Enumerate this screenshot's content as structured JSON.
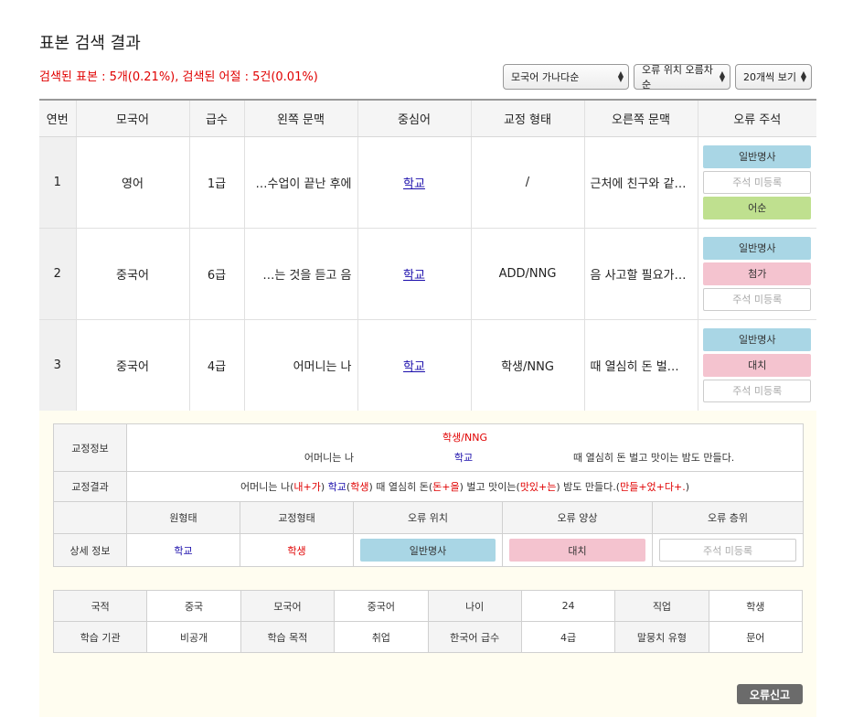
{
  "title": "표본 검색 결과",
  "summary": "검색된 표본 : 5개(0.21%), 검색된 어절 : 5건(0.01%)",
  "selects": {
    "sort_lang": "모국어 가나다순",
    "sort_err": "오류 위치 오름차순",
    "page_size": "20개씩 보기"
  },
  "table": {
    "headers": [
      "연번",
      "모국어",
      "급수",
      "왼쪽 문맥",
      "중심어",
      "교정 형태",
      "오른쪽 문맥",
      "오류 주석"
    ],
    "rows": [
      {
        "no": "1",
        "lang": "영어",
        "level": "1급",
        "left": "…수업이 끝난 후에",
        "keyword": "학교",
        "corr": "/",
        "right": "근처에 친구와 같…",
        "tags": [
          {
            "label": "일반명사",
            "style": "blue"
          },
          {
            "label": "주석 미등록",
            "style": "empty"
          },
          {
            "label": "어순",
            "style": "green"
          }
        ]
      },
      {
        "no": "2",
        "lang": "중국어",
        "level": "6급",
        "left": "…는 것을 듣고 음",
        "keyword": "학교",
        "corr": "ADD/NNG",
        "right": "음 사고할 필요가…",
        "tags": [
          {
            "label": "일반명사",
            "style": "blue"
          },
          {
            "label": "첨가",
            "style": "pink"
          },
          {
            "label": "주석 미등록",
            "style": "empty"
          }
        ]
      },
      {
        "no": "3",
        "lang": "중국어",
        "level": "4급",
        "left": "어머니는 나",
        "keyword": "학교",
        "corr": "학생/NNG",
        "right": "때 열심히 돈 벌…",
        "tags": [
          {
            "label": "일반명사",
            "style": "blue"
          },
          {
            "label": "대치",
            "style": "pink"
          },
          {
            "label": "주석 미등록",
            "style": "empty"
          }
        ]
      }
    ]
  },
  "detail": {
    "corr_info_label": "교정정보",
    "corr_tag": "학생/NNG",
    "left_ctx": "어머니는 나",
    "keyword": "학교",
    "right_ctx": "때 열심히 돈 벌고 맛이는 밤도 만들다.",
    "corr_result_label": "교정결과",
    "result": {
      "p1": "어머니는 나(",
      "r1": "내+가",
      "p2": ") ",
      "b1": "학교",
      "p3": "(",
      "r2": "학생",
      "p4": ") 때 열심히 돈(",
      "r3": "돈+을",
      "p5": ") 벌고 맛이는(",
      "r4": "맛있+는",
      "p6": ") 밤도 만들다.(",
      "r5": "만들+었+다+.",
      "p7": ")"
    },
    "sub_headers": [
      "원형태",
      "교정형태",
      "오류 위치",
      "오류 양상",
      "오류 층위"
    ],
    "detail_label": "상세 정보",
    "orig_form": "학교",
    "corr_form": "학생",
    "err_pos": "일반명사",
    "err_type": "대치",
    "err_level": "주석 미등록"
  },
  "meta": {
    "row1": [
      "국적",
      "중국",
      "모국어",
      "중국어",
      "나이",
      "24",
      "직업",
      "학생"
    ],
    "row2": [
      "학습 기관",
      "비공개",
      "학습 목적",
      "취업",
      "한국어 급수",
      "4급",
      "말뭉치 유형",
      "문어"
    ]
  },
  "report_button": "오류신고",
  "colors": {
    "tag_blue": "#a9d6e5",
    "tag_pink": "#f4c3cf",
    "tag_green": "#bfe08f",
    "summary_red": "#e00000",
    "keyword_blue": "#1a0dab"
  }
}
